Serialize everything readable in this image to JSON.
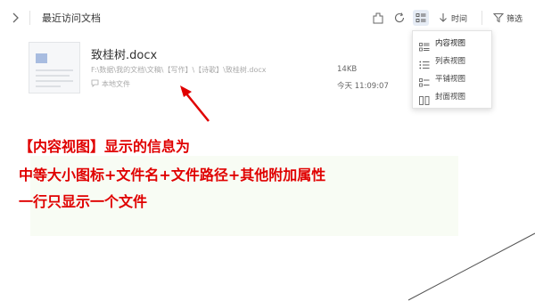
{
  "header": {
    "title": "最近访问文档",
    "sort_label": "时间",
    "filter_label": "筛选"
  },
  "file": {
    "name": "致桂树.docx",
    "path": "F:\\数据\\我的文档\\文稿\\【写作】\\【诗歌】\\致桂树.docx",
    "location": "本地文件",
    "size": "14KB",
    "date": "今天 11:09:07"
  },
  "view_menu": {
    "items": [
      {
        "label": "内容视图",
        "icon": "content-view-icon",
        "selected": true
      },
      {
        "label": "列表视图",
        "icon": "list-view-icon",
        "selected": false
      },
      {
        "label": "平铺视图",
        "icon": "tile-view-icon",
        "selected": false
      },
      {
        "label": "封面视图",
        "icon": "cover-view-icon",
        "selected": false
      }
    ]
  },
  "annotation": {
    "line1": "【内容视图】显示的信息为",
    "line2": "中等大小图标+文件名+文件路径+其他附加属性",
    "line3": "一行只显示一个文件"
  },
  "colors": {
    "annotation": "#e00000",
    "selected_bg": "#e6ecf5",
    "thumb_accent": "#a8bce0"
  }
}
